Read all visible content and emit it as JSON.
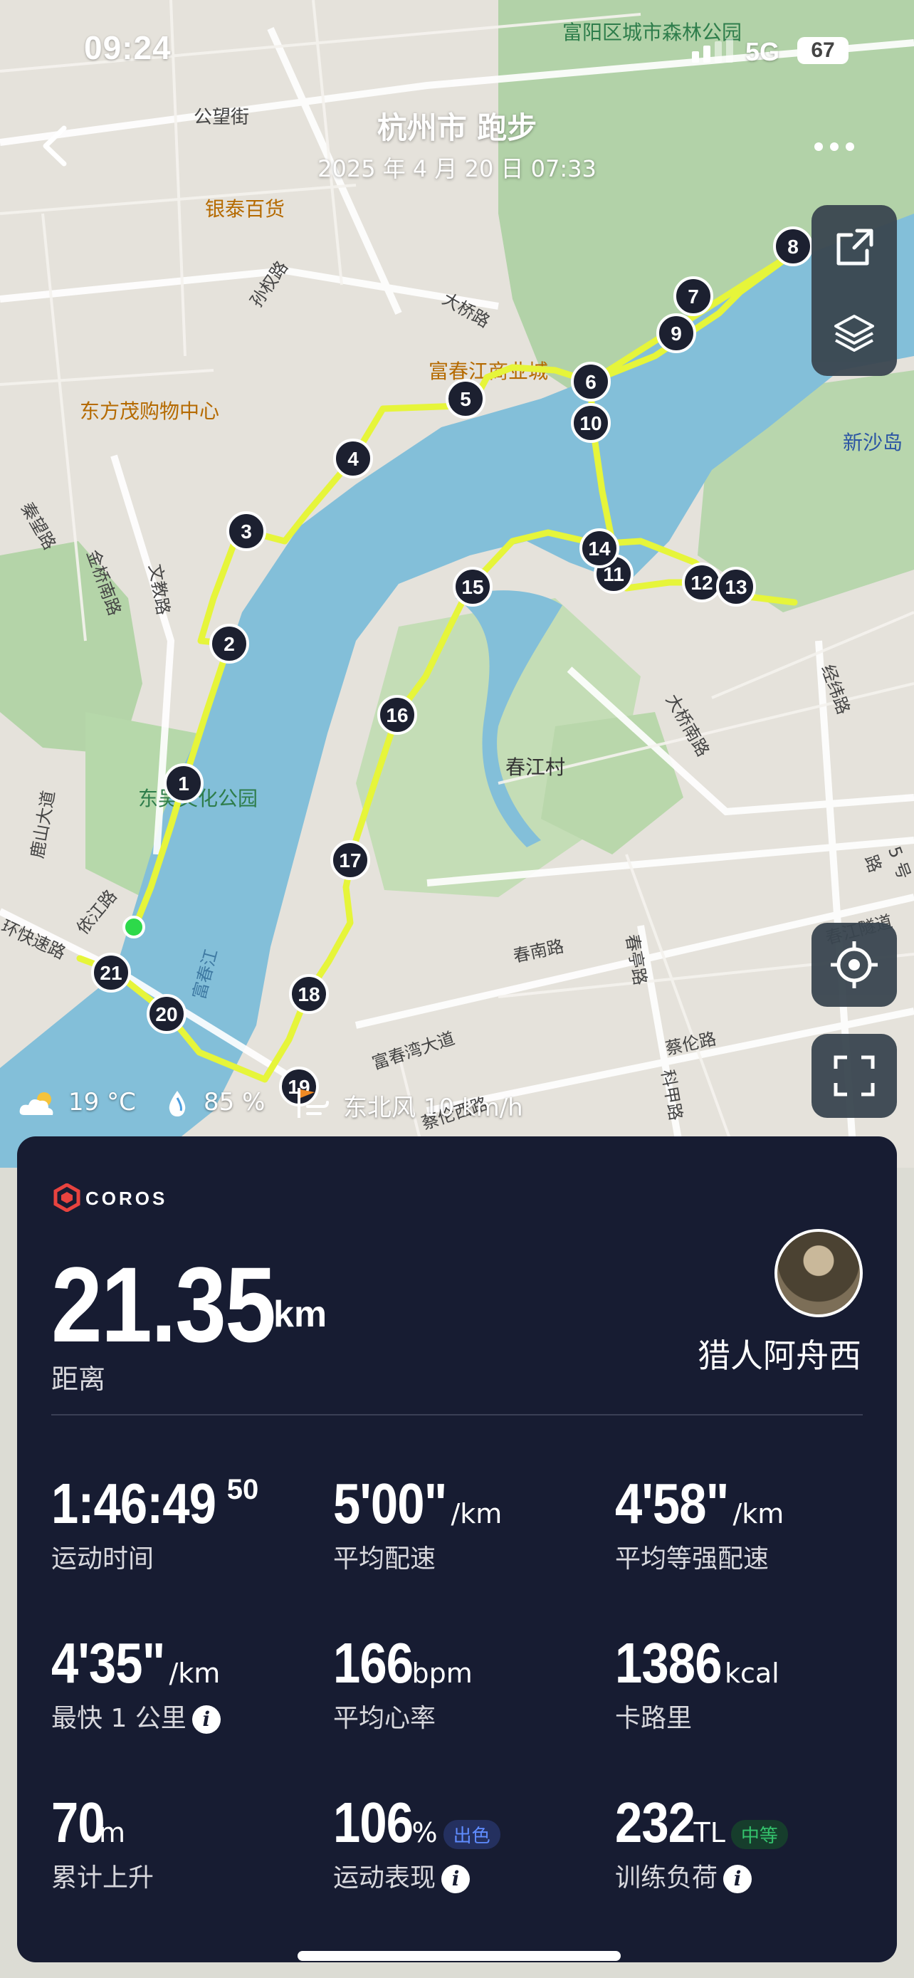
{
  "status_bar": {
    "time": "09:24",
    "network": "5G",
    "battery": "67"
  },
  "header": {
    "title": "杭州市 跑步",
    "subtitle": "2025 年 4 月 20 日 07:33"
  },
  "map": {
    "labels": {
      "park_north": "富阳区城市森林公园",
      "gongwang": "公望街",
      "yintai": "银泰百货",
      "sunquan": "孙权路",
      "daqiao": "大桥路",
      "fuchun_mall": "富春江商业城",
      "dongfangmao": "东方茂购物中心",
      "xinshadao": "新沙岛",
      "qinwang": "秦望路",
      "jinqiao_s": "金桥南路",
      "wenjiao": "文教路",
      "dongwu_park": "东吴文化公园",
      "luhushan": "鹿山大道",
      "yijiang": "依江路",
      "huankuai": "环快速路",
      "fuchunjiang": "富春江",
      "chunjiang_village": "春江村",
      "daqiao_south": "大桥南路",
      "jingqi": "经纬路",
      "wuhao": "5 号路",
      "chunjiang_tunnel": "春江隧道",
      "chunnan": "春南路",
      "chunting": "春亭路",
      "caipu": "蔡伦路",
      "kejia": "科甲路",
      "fuchunwan": "富春湾大道",
      "caipuxi": "蔡伦西路"
    },
    "km_markers": [
      "1",
      "2",
      "3",
      "4",
      "5",
      "6",
      "7",
      "8",
      "9",
      "10",
      "11",
      "12",
      "13",
      "14",
      "15",
      "16",
      "17",
      "18",
      "19",
      "20",
      "21"
    ]
  },
  "weather": {
    "temperature": "19 °C",
    "humidity": "85 %",
    "wind": "东北风 10 km/h"
  },
  "card": {
    "brand": "COROS",
    "distance": {
      "value": "21.35",
      "unit": "km",
      "label": "距离"
    },
    "username": "猎人阿舟西",
    "stats": {
      "time": {
        "value": "1:46:49",
        "sup": "50",
        "label": "运动时间"
      },
      "avg_pace": {
        "value": "5'00\"",
        "unit": "/km",
        "label": "平均配速"
      },
      "adj_pace": {
        "value": "4'58\"",
        "unit": "/km",
        "label": "平均等强配速"
      },
      "fastest_km": {
        "value": "4'35\"",
        "unit": "/km",
        "label": "最快 1 公里"
      },
      "avg_hr": {
        "value": "166",
        "unit": "bpm",
        "label": "平均心率"
      },
      "calories": {
        "value": "1386",
        "unit": "kcal",
        "label": "卡路里"
      },
      "elevation": {
        "value": "70",
        "unit": "m",
        "label": "累计上升"
      },
      "performance": {
        "value": "106",
        "unit": "%",
        "badge": "出色",
        "label": "运动表现"
      },
      "training_load": {
        "value": "232",
        "unit": "TL",
        "badge": "中等",
        "label": "训练负荷"
      }
    }
  },
  "colors": {
    "route": "#e6f53a",
    "card_bg": "#171c32",
    "river": "#83bfd9",
    "badge_blue": "#5f8cff",
    "badge_green": "#34c26c",
    "brand_red": "#e8433f"
  },
  "icons": [
    "back-icon",
    "more-icon",
    "share-icon",
    "layers-icon",
    "locate-icon",
    "fullscreen-icon",
    "cloud-icon",
    "drop-icon",
    "wind-icon",
    "info-icon",
    "signal-icon"
  ]
}
